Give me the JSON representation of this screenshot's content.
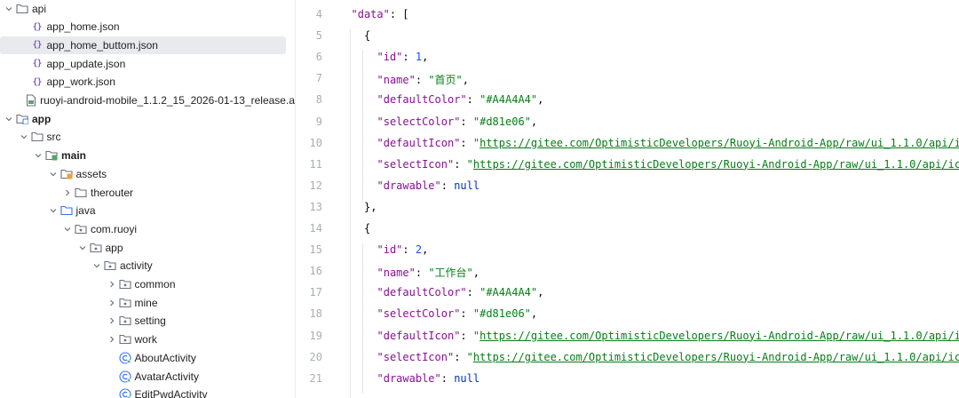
{
  "tree": {
    "items": [
      {
        "label": "api",
        "depth": 0,
        "kind": "folder",
        "chevron": "down",
        "bold": false
      },
      {
        "label": "app_home.json",
        "depth": 1,
        "kind": "json",
        "chevron": "none",
        "bold": false
      },
      {
        "label": "app_home_buttom.json",
        "depth": 1,
        "kind": "json",
        "chevron": "none",
        "bold": false,
        "selected": true
      },
      {
        "label": "app_update.json",
        "depth": 1,
        "kind": "json",
        "chevron": "none",
        "bold": false
      },
      {
        "label": "app_work.json",
        "depth": 1,
        "kind": "json",
        "chevron": "none",
        "bold": false
      },
      {
        "label": "ruoyi-android-mobile_1.1.2_15_2026-01-13_release.a",
        "depth": 1,
        "kind": "file",
        "chevron": "none",
        "bold": false
      },
      {
        "label": "app",
        "depth": 0,
        "kind": "module",
        "chevron": "down",
        "bold": true
      },
      {
        "label": "src",
        "depth": 1,
        "kind": "folder",
        "chevron": "down",
        "bold": false
      },
      {
        "label": "main",
        "depth": 2,
        "kind": "source-folder",
        "chevron": "down",
        "bold": true
      },
      {
        "label": "assets",
        "depth": 3,
        "kind": "resource-folder",
        "chevron": "down",
        "bold": false
      },
      {
        "label": "therouter",
        "depth": 4,
        "kind": "folder",
        "chevron": "right",
        "bold": false
      },
      {
        "label": "java",
        "depth": 3,
        "kind": "java-folder",
        "chevron": "down",
        "bold": false
      },
      {
        "label": "com.ruoyi",
        "depth": 4,
        "kind": "package",
        "chevron": "down",
        "bold": false
      },
      {
        "label": "app",
        "depth": 5,
        "kind": "package",
        "chevron": "down",
        "bold": false
      },
      {
        "label": "activity",
        "depth": 6,
        "kind": "package",
        "chevron": "down",
        "bold": false
      },
      {
        "label": "common",
        "depth": 7,
        "kind": "package",
        "chevron": "right",
        "bold": false
      },
      {
        "label": "mine",
        "depth": 7,
        "kind": "package",
        "chevron": "right",
        "bold": false
      },
      {
        "label": "setting",
        "depth": 7,
        "kind": "package",
        "chevron": "right",
        "bold": false
      },
      {
        "label": "work",
        "depth": 7,
        "kind": "package",
        "chevron": "right",
        "bold": false
      },
      {
        "label": "AboutActivity",
        "depth": 7,
        "kind": "class",
        "chevron": "none",
        "bold": false
      },
      {
        "label": "AvatarActivity",
        "depth": 7,
        "kind": "class",
        "chevron": "none",
        "bold": false
      },
      {
        "label": "EditPwdActivity",
        "depth": 7,
        "kind": "class",
        "chevron": "none",
        "bold": false
      }
    ]
  },
  "editor": {
    "colors": {
      "key": "#871094",
      "string": "#067d17",
      "number": "#1750eb",
      "keyword": "#0033b3",
      "line_number": "#a9adb5"
    },
    "lines": [
      {
        "num": "4",
        "indent": 1,
        "tokens": [
          {
            "t": "\"data\"",
            "c": "k"
          },
          {
            "t": ": ["
          }
        ]
      },
      {
        "num": "5",
        "indent": 2,
        "tokens": [
          {
            "t": "{"
          }
        ]
      },
      {
        "num": "6",
        "indent": 3,
        "tokens": [
          {
            "t": "\"id\"",
            "c": "k"
          },
          {
            "t": ": "
          },
          {
            "t": "1",
            "c": "n"
          },
          {
            "t": ","
          }
        ]
      },
      {
        "num": "7",
        "indent": 3,
        "tokens": [
          {
            "t": "\"name\"",
            "c": "k"
          },
          {
            "t": ": "
          },
          {
            "t": "\"首页\"",
            "c": "s"
          },
          {
            "t": ","
          }
        ]
      },
      {
        "num": "8",
        "indent": 3,
        "tokens": [
          {
            "t": "\"defaultColor\"",
            "c": "k"
          },
          {
            "t": ": "
          },
          {
            "t": "\"#A4A4A4\"",
            "c": "s"
          },
          {
            "t": ","
          }
        ]
      },
      {
        "num": "9",
        "indent": 3,
        "tokens": [
          {
            "t": "\"selectColor\"",
            "c": "k"
          },
          {
            "t": ": "
          },
          {
            "t": "\"#d81e06\"",
            "c": "s"
          },
          {
            "t": ","
          }
        ]
      },
      {
        "num": "10",
        "indent": 3,
        "tokens": [
          {
            "t": "\"defaultIcon\"",
            "c": "k"
          },
          {
            "t": ": "
          },
          {
            "t": "\"",
            "c": "s"
          },
          {
            "t": "https://gitee.com/OptimisticDevelopers/Ruoyi-Android-App/raw/ui_1.1.0/api/icon/h",
            "c": "u"
          }
        ]
      },
      {
        "num": "11",
        "indent": 3,
        "tokens": [
          {
            "t": "\"selectIcon\"",
            "c": "k"
          },
          {
            "t": ": "
          },
          {
            "t": "\"",
            "c": "s"
          },
          {
            "t": "https://gitee.com/OptimisticDevelopers/Ruoyi-Android-App/raw/ui_1.1.0/api/icon/ho",
            "c": "u"
          }
        ]
      },
      {
        "num": "12",
        "indent": 3,
        "tokens": [
          {
            "t": "\"drawable\"",
            "c": "k"
          },
          {
            "t": ": "
          },
          {
            "t": "null",
            "c": "kw"
          }
        ]
      },
      {
        "num": "13",
        "indent": 2,
        "tokens": [
          {
            "t": "},"
          }
        ]
      },
      {
        "num": "14",
        "indent": 2,
        "tokens": [
          {
            "t": "{"
          }
        ]
      },
      {
        "num": "15",
        "indent": 3,
        "tokens": [
          {
            "t": "\"id\"",
            "c": "k"
          },
          {
            "t": ": "
          },
          {
            "t": "2",
            "c": "n"
          },
          {
            "t": ","
          }
        ]
      },
      {
        "num": "16",
        "indent": 3,
        "tokens": [
          {
            "t": "\"name\"",
            "c": "k"
          },
          {
            "t": ": "
          },
          {
            "t": "\"工作台\"",
            "c": "s"
          },
          {
            "t": ","
          }
        ]
      },
      {
        "num": "17",
        "indent": 3,
        "tokens": [
          {
            "t": "\"defaultColor\"",
            "c": "k"
          },
          {
            "t": ": "
          },
          {
            "t": "\"#A4A4A4\"",
            "c": "s"
          },
          {
            "t": ","
          }
        ]
      },
      {
        "num": "18",
        "indent": 3,
        "tokens": [
          {
            "t": "\"selectColor\"",
            "c": "k"
          },
          {
            "t": ": "
          },
          {
            "t": "\"#d81e06\"",
            "c": "s"
          },
          {
            "t": ","
          }
        ]
      },
      {
        "num": "19",
        "indent": 3,
        "tokens": [
          {
            "t": "\"defaultIcon\"",
            "c": "k"
          },
          {
            "t": ": "
          },
          {
            "t": "\"",
            "c": "s"
          },
          {
            "t": "https://gitee.com/OptimisticDevelopers/Ruoyi-Android-App/raw/ui_1.1.0/api/icon/w",
            "c": "u"
          }
        ]
      },
      {
        "num": "20",
        "indent": 3,
        "tokens": [
          {
            "t": "\"selectIcon\"",
            "c": "k"
          },
          {
            "t": ": "
          },
          {
            "t": "\"",
            "c": "s"
          },
          {
            "t": "https://gitee.com/OptimisticDevelopers/Ruoyi-Android-App/raw/ui_1.1.0/api/icon/wo",
            "c": "u"
          }
        ]
      },
      {
        "num": "21",
        "indent": 3,
        "tokens": [
          {
            "t": "\"drawable\"",
            "c": "k"
          },
          {
            "t": ": "
          },
          {
            "t": "null",
            "c": "kw"
          }
        ]
      }
    ]
  }
}
